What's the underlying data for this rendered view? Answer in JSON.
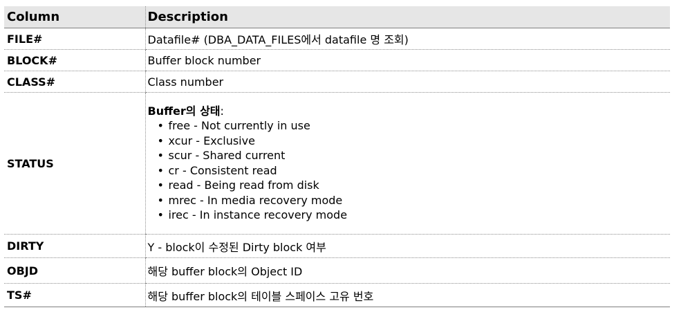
{
  "header": {
    "column": "Column",
    "description": "Description"
  },
  "rows": [
    {
      "name": "FILE#",
      "description": "Datafile# (DBA_DATA_FILES에서 datafile 명 조회)"
    },
    {
      "name": "BLOCK#",
      "description": "Buffer block number"
    },
    {
      "name": "CLASS#",
      "description": "Class number"
    },
    {
      "name": "STATUS",
      "description_title": "Buffer의 상태",
      "description_suffix": ":",
      "bullet_glyph": "•",
      "items": [
        "free - Not currently in use",
        "xcur - Exclusive",
        "scur - Shared current",
        "cr - Consistent read",
        "read - Being read from disk",
        "mrec - In media recovery mode",
        "irec - In instance recovery mode"
      ]
    },
    {
      "name": "DIRTY",
      "description": "Y - block이 수정된 Dirty block 여부"
    },
    {
      "name": "OBJD",
      "description": "해당 buffer block의 Object ID"
    },
    {
      "name": "TS#",
      "description": "해당 buffer block의 테이블 스페이스 고유 번호"
    }
  ],
  "colors": {
    "header_bg": "#e6e6e6",
    "rule": "#7f7f7f",
    "dotted_rule": "#8c8c8c"
  }
}
